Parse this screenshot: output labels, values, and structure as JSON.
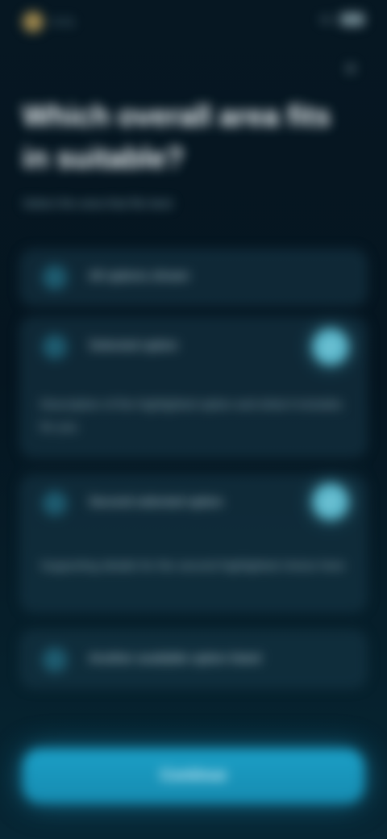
{
  "status_bar": {
    "time": "9:41",
    "signal": "5G"
  },
  "header": {
    "close_icon": "close-icon"
  },
  "question": {
    "title": "Which overall area fits in suitable?",
    "subtitle": "Select the area that fits best"
  },
  "options": [
    {
      "label": "All options shown",
      "icon": "radio-icon"
    },
    {
      "label": "Selected option",
      "icon": "radio-icon",
      "badge_icon": "check-icon",
      "description": "Description of the highlighted option and what it includes for you"
    },
    {
      "label": "Second selected option",
      "icon": "radio-icon",
      "badge_icon": "check-icon",
      "description": "Supporting details for the second highlighted choice here"
    },
    {
      "label": "Another available option listed",
      "icon": "radio-icon"
    }
  ],
  "cta": {
    "label": "Continue"
  },
  "colors": {
    "accent": "#1B9FC6",
    "background": "#061722"
  }
}
